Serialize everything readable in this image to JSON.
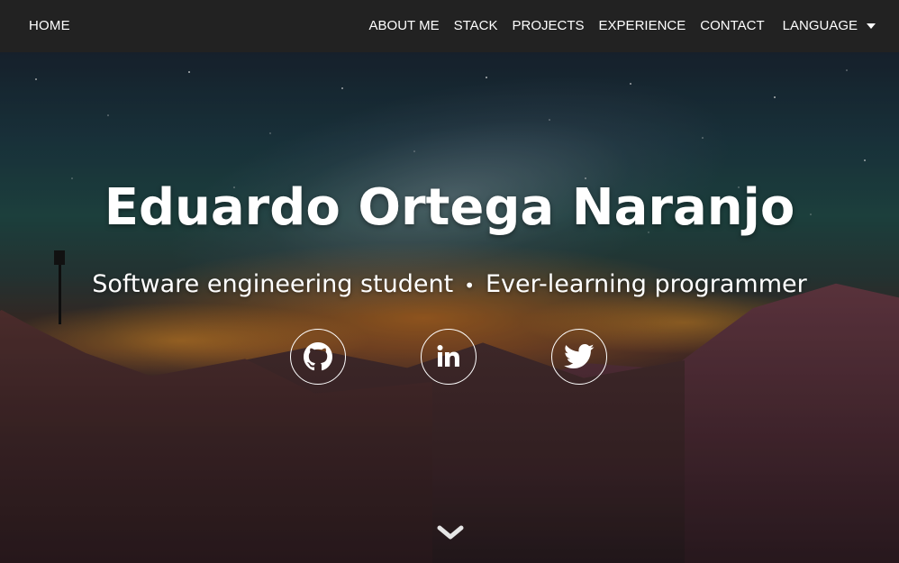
{
  "nav": {
    "home": "HOME",
    "items": [
      {
        "label": "ABOUT ME"
      },
      {
        "label": "STACK"
      },
      {
        "label": "PROJECTS"
      },
      {
        "label": "EXPERIENCE"
      },
      {
        "label": "CONTACT"
      }
    ],
    "language": "LANGUAGE"
  },
  "hero": {
    "name": "Eduardo Ortega Naranjo",
    "subtitle_left": "Software engineering student",
    "separator": "•",
    "subtitle_right": "Ever-learning programmer"
  },
  "social": [
    {
      "icon": "github-icon"
    },
    {
      "icon": "linkedin-icon"
    },
    {
      "icon": "twitter-icon"
    }
  ],
  "scroll": {
    "icon": "chevron-down-icon"
  },
  "colors": {
    "navbar_bg": "#222222",
    "text": "#ffffff"
  }
}
